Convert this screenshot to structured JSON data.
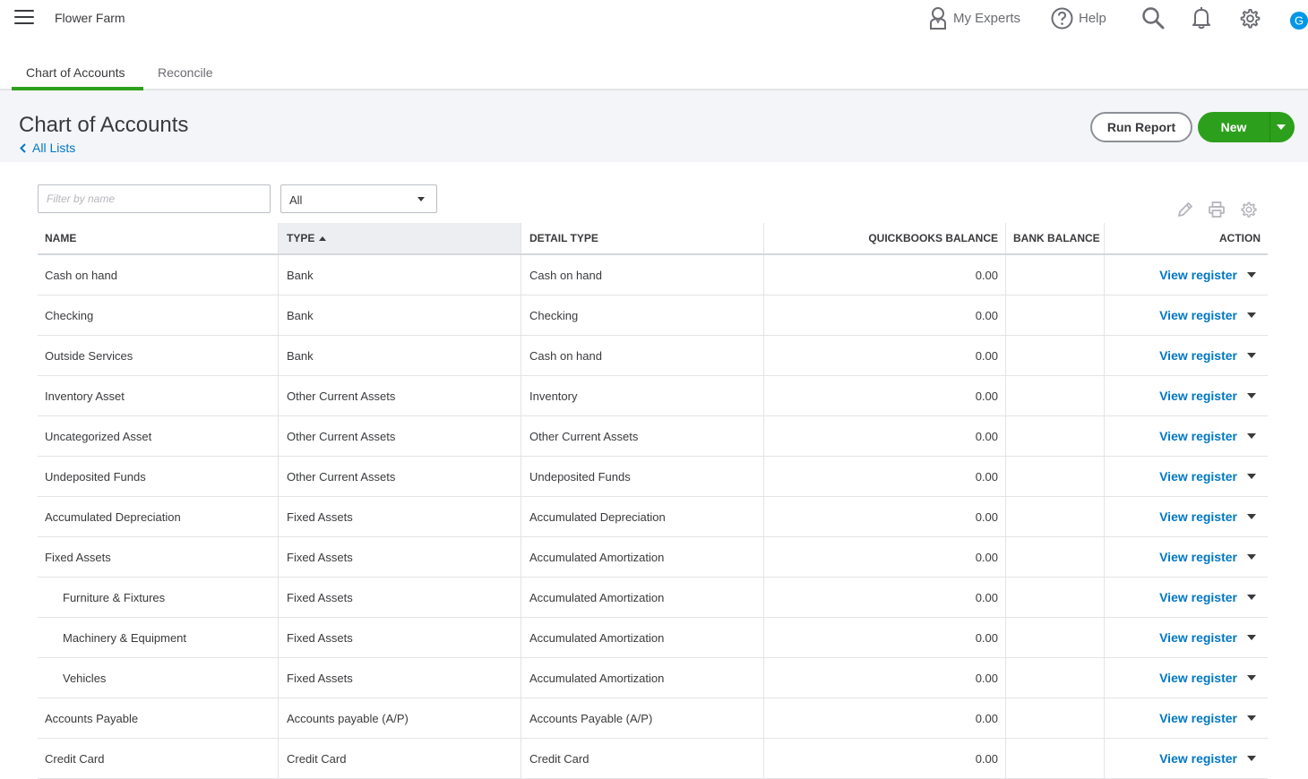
{
  "app": {
    "company_name": "Flower Farm",
    "nav": {
      "my_experts": "My Experts",
      "help": "Help",
      "avatar_initial": "G"
    }
  },
  "tabs": [
    {
      "label": "Chart of Accounts",
      "active": true
    },
    {
      "label": "Reconcile",
      "active": false
    }
  ],
  "page": {
    "title": "Chart of Accounts",
    "back_link": "All Lists",
    "run_report_label": "Run Report",
    "new_label": "New"
  },
  "filters": {
    "name_placeholder": "Filter by name",
    "type_value": "All"
  },
  "toolbar_icons": [
    "pencil-icon",
    "printer-icon",
    "settings-icon"
  ],
  "colors": {
    "accent_green": "#2ca01c",
    "link_blue": "#0077c5",
    "avatar_blue": "#0097e6"
  },
  "table": {
    "columns": {
      "name": "NAME",
      "type": "TYPE",
      "detail_type": "DETAIL TYPE",
      "qb_balance": "QUICKBOOKS BALANCE",
      "bank_balance": "BANK BALANCE",
      "action": "ACTION"
    },
    "sort_column": "type",
    "sort_direction": "ascending",
    "action_label": "View register",
    "rows": [
      {
        "name": "Cash on hand",
        "type": "Bank",
        "detail_type": "Cash on hand",
        "qb_balance": "0.00",
        "bank_balance": "",
        "sub": false
      },
      {
        "name": "Checking",
        "type": "Bank",
        "detail_type": "Checking",
        "qb_balance": "0.00",
        "bank_balance": "",
        "sub": false
      },
      {
        "name": "Outside Services",
        "type": "Bank",
        "detail_type": "Cash on hand",
        "qb_balance": "0.00",
        "bank_balance": "",
        "sub": false
      },
      {
        "name": "Inventory Asset",
        "type": "Other Current Assets",
        "detail_type": "Inventory",
        "qb_balance": "0.00",
        "bank_balance": "",
        "sub": false
      },
      {
        "name": "Uncategorized Asset",
        "type": "Other Current Assets",
        "detail_type": "Other Current Assets",
        "qb_balance": "0.00",
        "bank_balance": "",
        "sub": false
      },
      {
        "name": "Undeposited Funds",
        "type": "Other Current Assets",
        "detail_type": "Undeposited Funds",
        "qb_balance": "0.00",
        "bank_balance": "",
        "sub": false
      },
      {
        "name": "Accumulated Depreciation",
        "type": "Fixed Assets",
        "detail_type": "Accumulated Depreciation",
        "qb_balance": "0.00",
        "bank_balance": "",
        "sub": false
      },
      {
        "name": "Fixed Assets",
        "type": "Fixed Assets",
        "detail_type": "Accumulated Amortization",
        "qb_balance": "0.00",
        "bank_balance": "",
        "sub": false
      },
      {
        "name": "Furniture & Fixtures",
        "type": "Fixed Assets",
        "detail_type": "Accumulated Amortization",
        "qb_balance": "0.00",
        "bank_balance": "",
        "sub": true
      },
      {
        "name": "Machinery & Equipment",
        "type": "Fixed Assets",
        "detail_type": "Accumulated Amortization",
        "qb_balance": "0.00",
        "bank_balance": "",
        "sub": true
      },
      {
        "name": "Vehicles",
        "type": "Fixed Assets",
        "detail_type": "Accumulated Amortization",
        "qb_balance": "0.00",
        "bank_balance": "",
        "sub": true
      },
      {
        "name": "Accounts Payable",
        "type": "Accounts payable (A/P)",
        "detail_type": "Accounts Payable (A/P)",
        "qb_balance": "0.00",
        "bank_balance": "",
        "sub": false
      },
      {
        "name": "Credit Card",
        "type": "Credit Card",
        "detail_type": "Credit Card",
        "qb_balance": "0.00",
        "bank_balance": "",
        "sub": false
      }
    ]
  }
}
